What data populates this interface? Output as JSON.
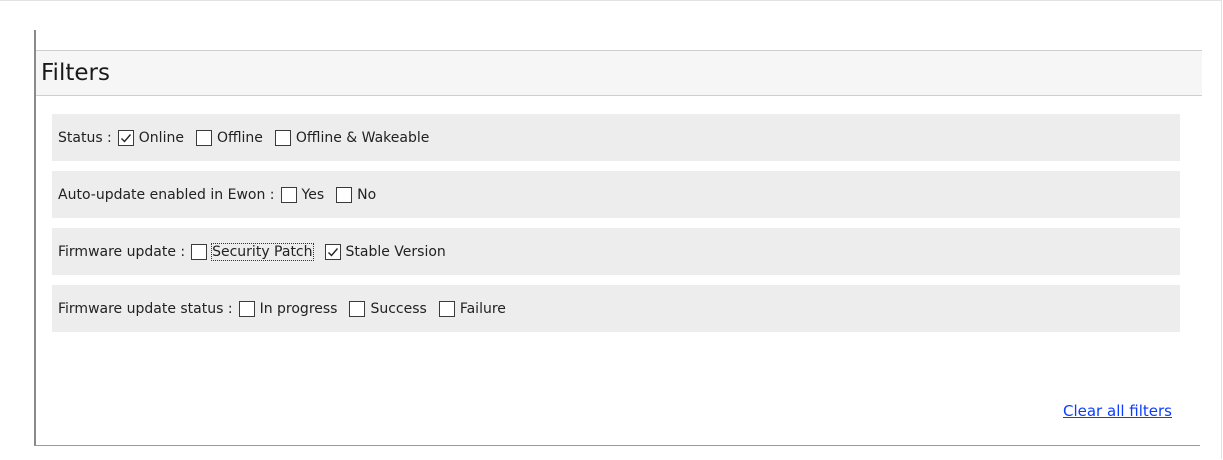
{
  "filters": {
    "title": "Filters",
    "status": {
      "label": "Status :",
      "options": [
        {
          "label": "Online",
          "checked": true
        },
        {
          "label": "Offline",
          "checked": false
        },
        {
          "label": "Offline & Wakeable",
          "checked": false
        }
      ]
    },
    "auto_update": {
      "label": "Auto-update enabled in Ewon :",
      "options": [
        {
          "label": "Yes",
          "checked": false
        },
        {
          "label": "No",
          "checked": false
        }
      ]
    },
    "firmware_update": {
      "label": "Firmware update :",
      "options": [
        {
          "label": "Security Patch",
          "checked": false,
          "focused": true
        },
        {
          "label": "Stable Version",
          "checked": true
        }
      ]
    },
    "firmware_status": {
      "label": "Firmware update status :",
      "options": [
        {
          "label": "In progress",
          "checked": false
        },
        {
          "label": "Success",
          "checked": false
        },
        {
          "label": "Failure",
          "checked": false
        }
      ]
    },
    "clear_label": "Clear all filters"
  }
}
